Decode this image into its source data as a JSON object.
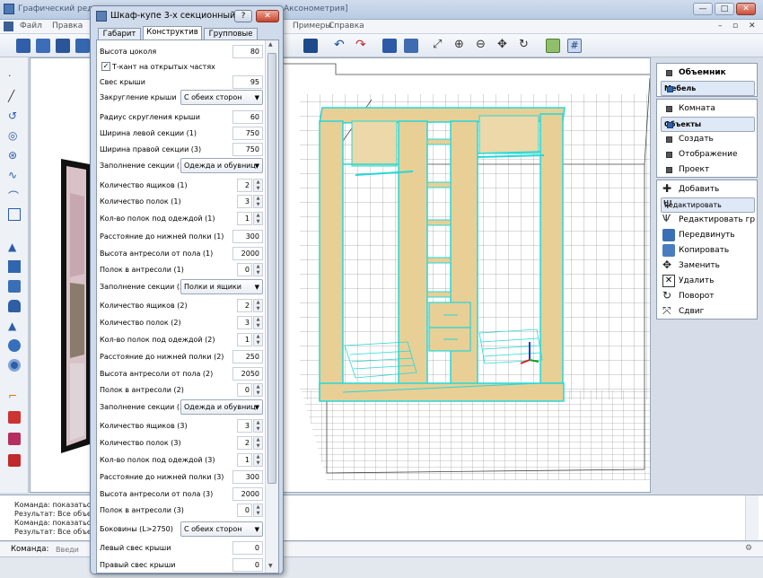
{
  "window": {
    "title_visible": "Графический реда",
    "title_tail": "Аксонометрия]",
    "buttons": {
      "min": "—",
      "max": "□",
      "close": "✕"
    }
  },
  "menu": [
    "Файл",
    "Правка",
    "Примеры",
    "Справка"
  ],
  "dialog": {
    "title": "Шкаф-купе 3-х секционный",
    "help": "?",
    "close": "✕",
    "tabs": [
      "Габарит",
      "Конструктив",
      "Групповые"
    ],
    "active_tab": "Конструктив",
    "fields": [
      {
        "label": "Высота цоколя",
        "type": "num",
        "value": "80"
      },
      {
        "label": "Т-кант на открытых частях",
        "type": "check",
        "value": "✓"
      },
      {
        "label": "Свес крыши",
        "type": "num",
        "value": "95"
      },
      {
        "label": "Закругление крыши",
        "type": "select",
        "value": "С обеих сторон"
      },
      {
        "label": "Радиус скругления крыши",
        "type": "num",
        "value": "60"
      },
      {
        "label": "Ширина левой секции (1)",
        "type": "num",
        "value": "750"
      },
      {
        "label": "Ширина правой секции (3)",
        "type": "num",
        "value": "750"
      },
      {
        "label": "Заполнение секции (1)",
        "type": "select",
        "value": "Одежда и обувниц"
      },
      {
        "label": "Количество ящиков (1)",
        "type": "spin",
        "value": "2"
      },
      {
        "label": "Количество полок (1)",
        "type": "spin",
        "value": "3"
      },
      {
        "label": "Кол-во полок под одеждой (1)",
        "type": "spin",
        "value": "1"
      },
      {
        "label": "Расстояние до нижней полки (1)",
        "type": "num",
        "value": "300"
      },
      {
        "label": "Высота антресоли от пола (1)",
        "type": "num",
        "value": "2000"
      },
      {
        "label": "Полок в антресоли (1)",
        "type": "spin",
        "value": "0"
      },
      {
        "label": "Заполнение секции (2)",
        "type": "select",
        "value": "Полки и ящики"
      },
      {
        "label": "Количество ящиков (2)",
        "type": "spin",
        "value": "2"
      },
      {
        "label": "Количество полок (2)",
        "type": "spin",
        "value": "3"
      },
      {
        "label": "Кол-во полок под одеждой (2)",
        "type": "spin",
        "value": "1"
      },
      {
        "label": "Расстояние до нижней полки (2)",
        "type": "num",
        "value": "250"
      },
      {
        "label": "Высота антресоли от пола (2)",
        "type": "num",
        "value": "2050"
      },
      {
        "label": "Полок в антресоли (2)",
        "type": "spin",
        "value": "0"
      },
      {
        "label": "Заполнение секции (3)",
        "type": "select",
        "value": "Одежда и обувниц"
      },
      {
        "label": "Количество ящиков (3)",
        "type": "spin",
        "value": "3"
      },
      {
        "label": "Количество полок (3)",
        "type": "spin",
        "value": "2"
      },
      {
        "label": "Кол-во полок под одеждой (3)",
        "type": "spin",
        "value": "1"
      },
      {
        "label": "Расстояние до нижней полки (3)",
        "type": "num",
        "value": "300"
      },
      {
        "label": "Высота антресоли от пола (3)",
        "type": "num",
        "value": "2000"
      },
      {
        "label": "Полок в антресоли (3)",
        "type": "spin",
        "value": "0"
      },
      {
        "label": "Боковины (L>2750)",
        "type": "select",
        "value": "С обеих сторон"
      },
      {
        "label": "Левый свес крыши",
        "type": "num",
        "value": "0"
      },
      {
        "label": "Правый свес крыши",
        "type": "num",
        "value": "0"
      }
    ]
  },
  "right_panel": {
    "top": [
      {
        "label": "Объемник",
        "bold": true,
        "selected": false
      },
      {
        "label": "Мебель",
        "bold": true,
        "selected": true
      }
    ],
    "middle": [
      {
        "label": "Комната",
        "bold": false,
        "selected": false
      },
      {
        "label": "Объекты",
        "bold": true,
        "selected": true
      },
      {
        "label": "Создать",
        "bold": false,
        "selected": false
      },
      {
        "label": "Отображение",
        "bold": false,
        "selected": false
      },
      {
        "label": "Проект",
        "bold": false,
        "selected": false
      }
    ],
    "actions": [
      {
        "label": "Добавить",
        "icon": "add-icon"
      },
      {
        "label": "Редактировать",
        "icon": "edit-icon"
      },
      {
        "label": "Редактировать гру...",
        "icon": "group-edit-icon"
      },
      {
        "label": "Передвинуть",
        "icon": "move-icon"
      },
      {
        "label": "Копировать",
        "icon": "copy-icon"
      },
      {
        "label": "Заменить",
        "icon": "replace-icon"
      },
      {
        "label": "Удалить",
        "icon": "delete-icon"
      },
      {
        "label": "Поворот",
        "icon": "rotate-icon"
      },
      {
        "label": "Сдвиг",
        "icon": "shift-icon"
      }
    ]
  },
  "command_log": [
    "Команда: показатьоо",
    "Результат: Все объект",
    "Команда: показатьоо",
    "Результат: Все объект"
  ],
  "command_line": {
    "label": "Команда:",
    "placeholder": "Введи"
  },
  "colors": {
    "wood": "#e8cf96",
    "cyan": "#25d8d8",
    "grid": "#6f6f6f",
    "axis_x": "#e02020",
    "axis_y": "#1f9a1f",
    "axis_z": "#1a3fd6"
  }
}
